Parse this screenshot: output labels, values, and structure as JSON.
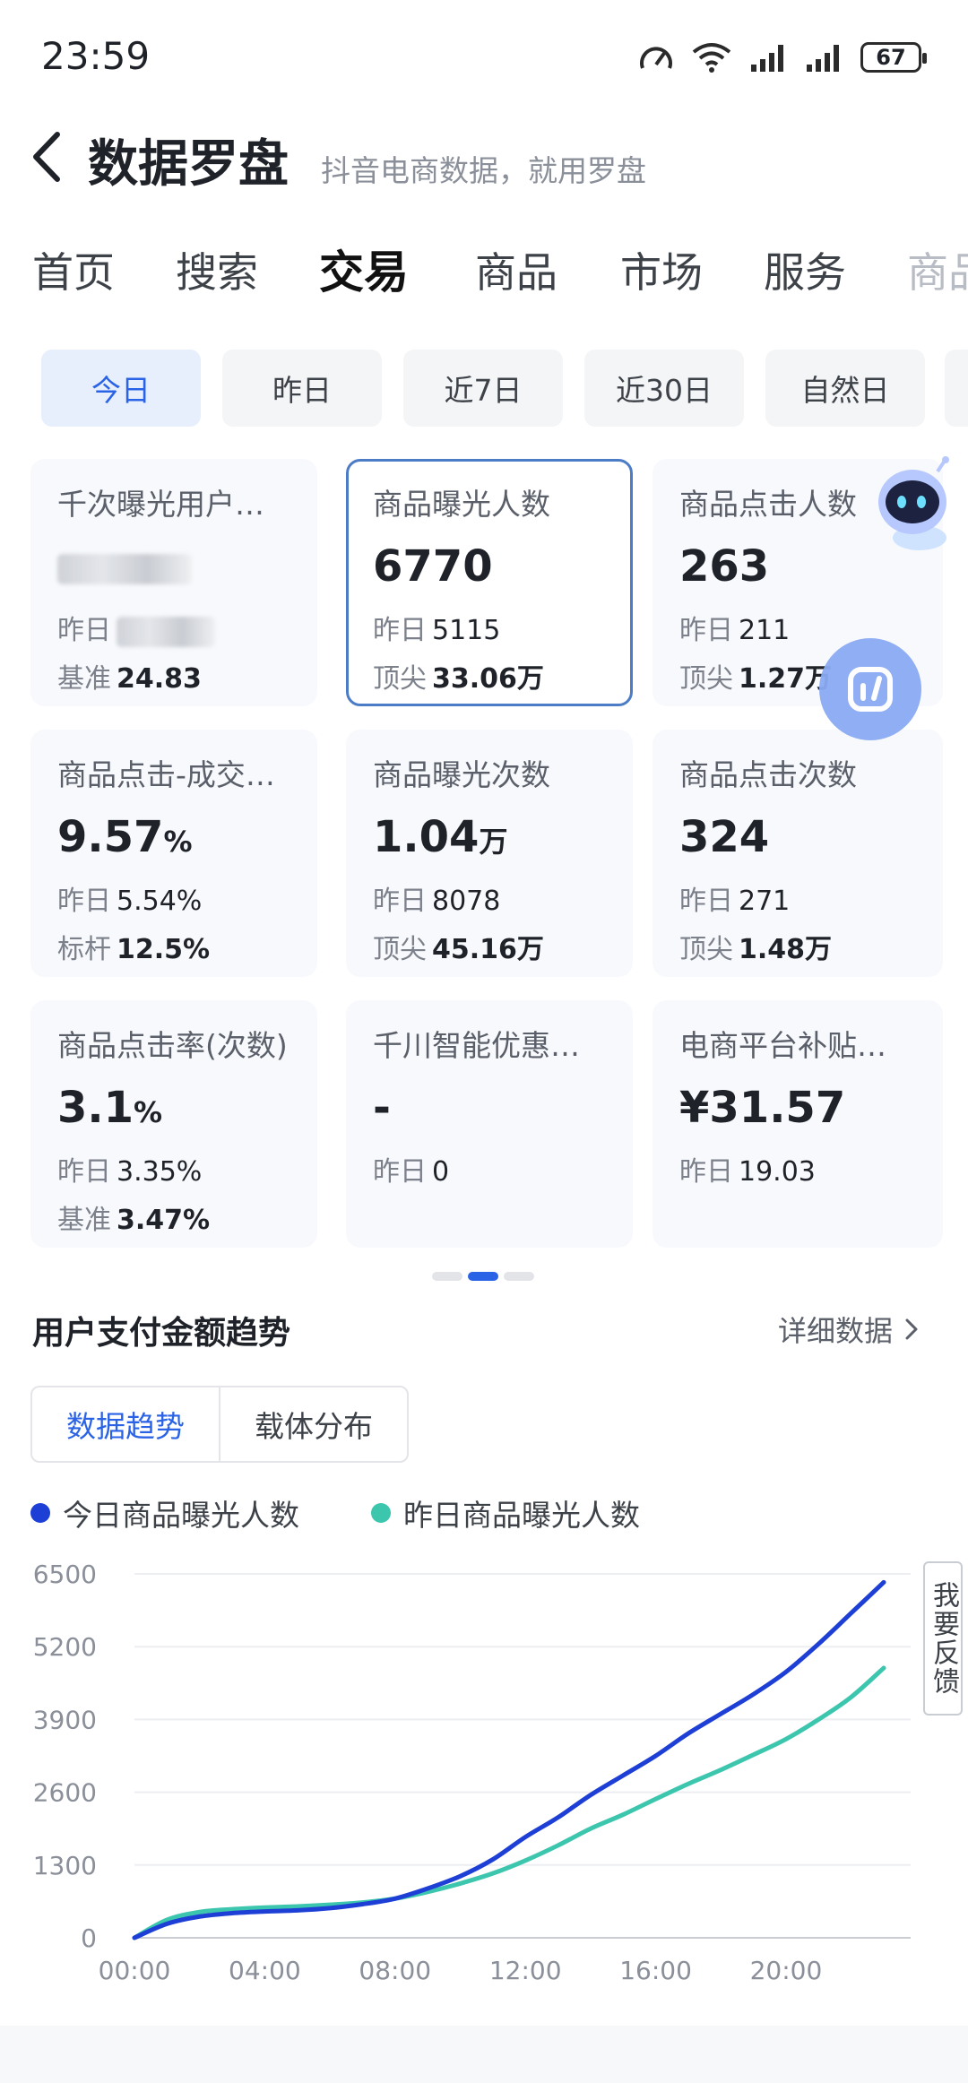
{
  "status_bar": {
    "time": "23:59",
    "battery": "67"
  },
  "header": {
    "title": "数据罗盘",
    "subtitle": "抖音电商数据，就用罗盘"
  },
  "main_tabs": [
    "首页",
    "搜索",
    "交易",
    "商品",
    "市场",
    "服务",
    "商品"
  ],
  "active_main_tab": "交易",
  "date_filters": [
    "今日",
    "昨日",
    "近7日",
    "近30日",
    "自然日"
  ],
  "active_date_filter": "今日",
  "metric_cards": [
    {
      "title": "千次曝光用户…",
      "value": "",
      "row1_label": "昨日",
      "row1_value": "",
      "row2_label": "基准",
      "row2_value": "24.83"
    },
    {
      "title": "商品曝光人数",
      "value": "6770",
      "row1_label": "昨日",
      "row1_value": "5115",
      "row2_label": "顶尖",
      "row2_value": "33.06万"
    },
    {
      "title": "商品点击人数",
      "value": "263",
      "row1_label": "昨日",
      "row1_value": "211",
      "row2_label": "顶尖",
      "row2_value": "1.27万"
    },
    {
      "title": "商品点击-成交…",
      "value": "9.57",
      "value_unit": "%",
      "row1_label": "昨日",
      "row1_value": "5.54%",
      "row2_label": "标杆",
      "row2_value": "12.5%"
    },
    {
      "title": "商品曝光次数",
      "value": "1.04",
      "value_unit": "万",
      "row1_label": "昨日",
      "row1_value": "8078",
      "row2_label": "顶尖",
      "row2_value": "45.16万"
    },
    {
      "title": "商品点击次数",
      "value": "324",
      "row1_label": "昨日",
      "row1_value": "271",
      "row2_label": "顶尖",
      "row2_value": "1.48万"
    },
    {
      "title": "商品点击率(次数)",
      "value": "3.1",
      "value_unit": "%",
      "row1_label": "昨日",
      "row1_value": "3.35%",
      "row2_label": "基准",
      "row2_value": "3.47%"
    },
    {
      "title": "千川智能优惠…",
      "value": "-",
      "row1_label": "昨日",
      "row1_value": "0"
    },
    {
      "title": "电商平台补贴…",
      "value": "¥31.57",
      "row1_label": "昨日",
      "row1_value": "19.03"
    }
  ],
  "pager": {
    "total": 3,
    "active": 2
  },
  "trend_section": {
    "title": "用户支付金额趋势",
    "detail_link": "详细数据",
    "tabs": [
      "数据趋势",
      "载体分布"
    ],
    "active_tab": "数据趋势"
  },
  "feedback_label": "我要反馈",
  "chart_data": {
    "type": "line",
    "x": [
      "00:00",
      "01:00",
      "02:00",
      "03:00",
      "04:00",
      "05:00",
      "06:00",
      "07:00",
      "08:00",
      "09:00",
      "10:00",
      "11:00",
      "12:00",
      "13:00",
      "14:00",
      "15:00",
      "16:00",
      "17:00",
      "18:00",
      "19:00",
      "20:00",
      "21:00",
      "22:00",
      "23:00"
    ],
    "xticks": [
      "00:00",
      "04:00",
      "08:00",
      "12:00",
      "16:00",
      "20:00"
    ],
    "yticks": [
      0,
      1300,
      2600,
      3900,
      5200,
      6500
    ],
    "ylim": [
      0,
      6500
    ],
    "grid": true,
    "legend_position": "top-left",
    "series": [
      {
        "name": "今日商品曝光人数",
        "color": "#1d3fd6",
        "values": [
          0,
          250,
          380,
          440,
          470,
          490,
          530,
          600,
          700,
          880,
          1100,
          1400,
          1800,
          2150,
          2550,
          2900,
          3250,
          3650,
          4000,
          4350,
          4750,
          5250,
          5800,
          6350
        ]
      },
      {
        "name": "昨日商品曝光人数",
        "color": "#3cc6ae",
        "values": [
          0,
          320,
          460,
          510,
          540,
          560,
          590,
          630,
          700,
          820,
          970,
          1150,
          1380,
          1650,
          1950,
          2200,
          2480,
          2750,
          3000,
          3270,
          3550,
          3900,
          4300,
          4820
        ]
      }
    ]
  }
}
